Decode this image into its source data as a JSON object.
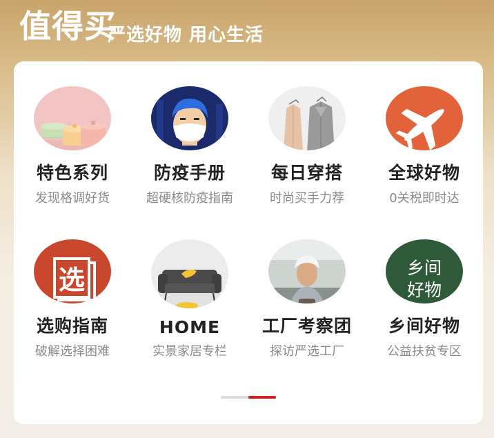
{
  "header": {
    "brand": "值得买",
    "slogan": "严选好物 用心生活"
  },
  "accent_color": "#d0212b",
  "pager": {
    "total_pages": 2,
    "current_page": 2
  },
  "items": [
    {
      "title": "特色系列",
      "subtitle": "发现格调好货",
      "image": "pastel-cookware-pots"
    },
    {
      "title": "防疫手册",
      "subtitle": "超硬核防疫指南",
      "image": "masked-person-illustration"
    },
    {
      "title": "每日穿搭",
      "subtitle": "时尚买手力荐",
      "image": "coats-on-hangers"
    },
    {
      "title": "全球好物",
      "subtitle": "0关税即时达",
      "image": "airplane-icon"
    },
    {
      "title": "选购指南",
      "subtitle": "破解选择困难",
      "image": "xuan-book-icon"
    },
    {
      "title": "HOME",
      "subtitle": "实景家居专栏",
      "image": "grey-sofa"
    },
    {
      "title": "工厂考察团",
      "subtitle": "探访严选工厂",
      "image": "factory-worker"
    },
    {
      "title": "乡间好物",
      "subtitle": "公益扶贫专区",
      "image": "village-goods-badge"
    }
  ]
}
